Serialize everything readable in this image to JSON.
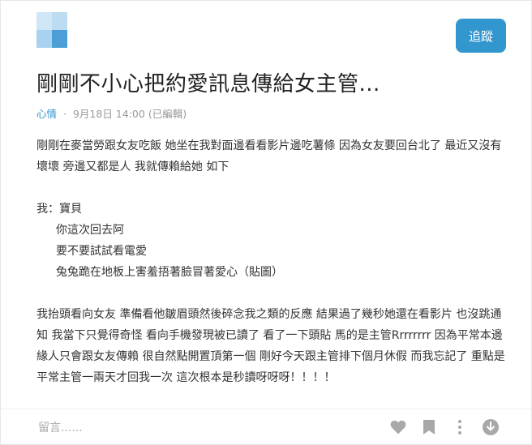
{
  "header": {
    "follow_label": "追蹤"
  },
  "post": {
    "title": "剛剛不小心把約愛訊息傳給女主管...",
    "board": "心情",
    "separator": "·",
    "date": "9月18日 14:00",
    "edited": "(已編輯)"
  },
  "content": {
    "intro": "剛剛在麥當勞跟女友吃飯 她坐在我對面邊看看影片邊吃薯條 因為女友要回台北了 最近又沒有壞壞 旁邊又都是人 我就傳賴給她 如下",
    "me_label": "我：寶貝",
    "messages": [
      "你這次回去阿",
      "要不要試試看電愛",
      "兔兔跪在地板上害羞捂著臉冒著愛心（貼圖）"
    ],
    "ending": "我抬頭看向女友 準備看他皺眉頭然後碎念我之類的反應 結果過了幾秒她還在看影片 也沒跳通知 我當下只覺得奇怪 看向手機發現被已讀了 看了一下頭貼 馬的是主管Rrrrrrrr 因為平常本邊緣人只會跟女友傳賴 很自然點開置頂第一個 剛好今天跟主管排下個月休假 而我忘記了 重點是平常主管一兩天才回我一次 這次根本是秒讀呀呀呀！！！！"
  },
  "footer": {
    "comment_placeholder": "留言......",
    "icons": [
      "heart-icon",
      "bookmark-icon",
      "more-icon",
      "scroll-down-icon"
    ]
  },
  "colors": {
    "accent": "#3397cf",
    "avatar_blue": "#4b9fd6",
    "icon_gray": "#a8a8a8"
  }
}
